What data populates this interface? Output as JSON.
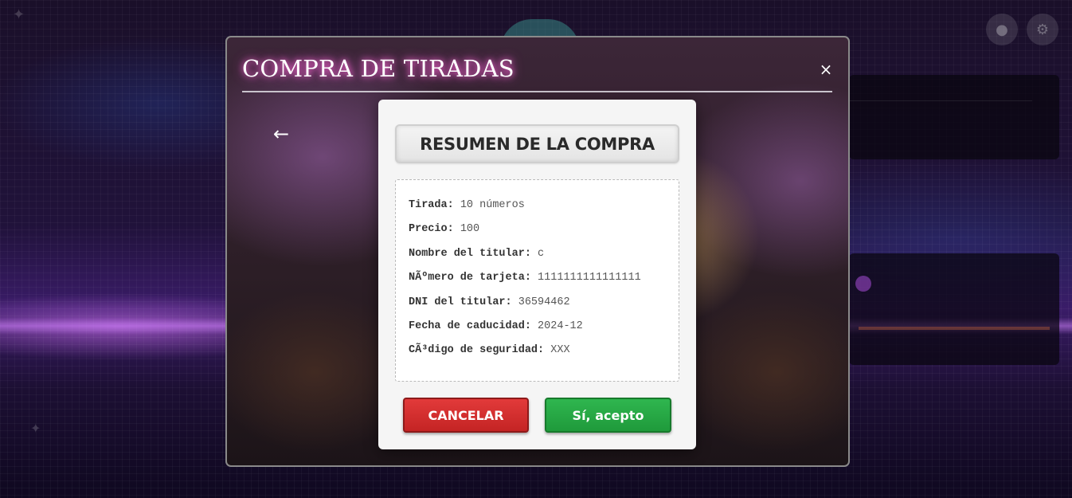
{
  "modal": {
    "title": "COMPRA DE TIRADAS",
    "close_icon": "×",
    "back_icon": "←"
  },
  "summary": {
    "heading": "RESUMEN DE LA COMPRA",
    "details": [
      {
        "label": "Tirada:",
        "value": "10 números"
      },
      {
        "label": "Precio:",
        "value": "100"
      },
      {
        "label": "Nombre del titular:",
        "value": "c"
      },
      {
        "label": "NÃºmero de tarjeta:",
        "value": "1111111111111111"
      },
      {
        "label": "DNI del titular:",
        "value": "36594462"
      },
      {
        "label": "Fecha de caducidad:",
        "value": "2024-12"
      },
      {
        "label": "CÃ³digo de seguridad:",
        "value": "XXX"
      }
    ],
    "cancel_label": "CANCELAR",
    "accept_label": "Sí, acepto"
  },
  "colors": {
    "title_glow": "#ff6ad5",
    "cancel": "#d32f2f",
    "accept": "#28a745",
    "dialog_bg": "#f5f5f5"
  }
}
